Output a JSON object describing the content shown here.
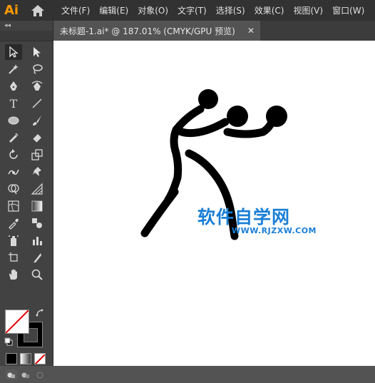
{
  "app": {
    "logo": "Ai"
  },
  "menu": {
    "items": [
      {
        "label": "文件(F)"
      },
      {
        "label": "编辑(E)"
      },
      {
        "label": "对象(O)"
      },
      {
        "label": "文字(T)"
      },
      {
        "label": "选择(S)"
      },
      {
        "label": "效果(C)"
      },
      {
        "label": "视图(V)"
      },
      {
        "label": "窗口(W)"
      }
    ]
  },
  "document": {
    "tab_title": "未标题-1.ai* @ 187.01% (CMYK/GPU 预览)",
    "close_glyph": "✕"
  },
  "toolbar": {
    "collapse_glyph": "◂◂",
    "text_tool_glyph": "T"
  },
  "watermark": {
    "main": "软件自学网",
    "url": "WWW.RJZXW.COM",
    "color": "#1a7fd6"
  },
  "colors": {
    "accent": "#ff9a00",
    "menubar_bg": "#323232",
    "panel_bg": "#424242",
    "canvas_bg": "#ffffff"
  }
}
